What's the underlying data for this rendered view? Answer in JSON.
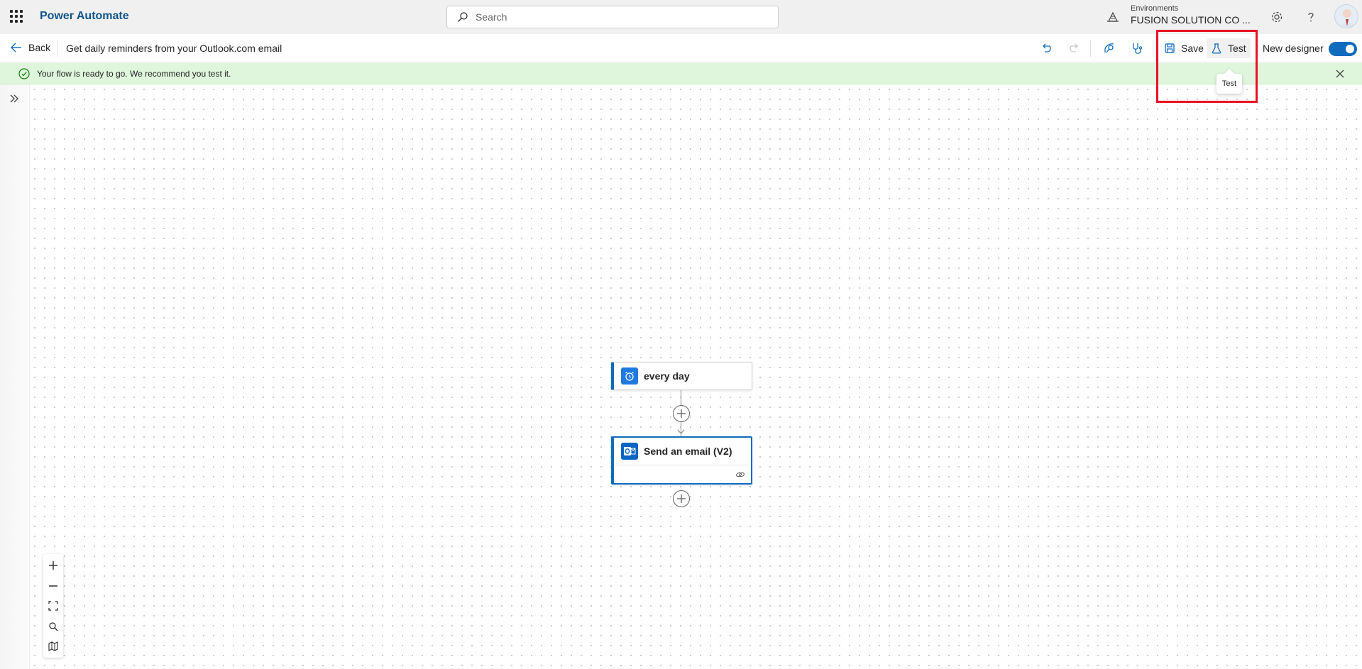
{
  "header": {
    "app_name": "Power Automate",
    "search_placeholder": "Search",
    "environment_label": "Environments",
    "environment_name": "FUSION SOLUTION CO ..."
  },
  "commandbar": {
    "back_label": "Back",
    "flow_title": "Get daily reminders from your Outlook.com email",
    "save_label": "Save",
    "test_label": "Test",
    "new_designer_label": "New designer",
    "new_designer_on": true,
    "tooltip": "Test"
  },
  "message": {
    "text": "Your flow is ready to go. We recommend you test it."
  },
  "flow": {
    "trigger_title": "every day",
    "action_title": "Send an email (V2)"
  },
  "colors": {
    "brand": "#0f548c",
    "accent": "#0f6cbd",
    "success_bg": "#dff6dd",
    "highlight": "#e81123"
  },
  "icons": [
    "waffle-icon",
    "search-icon",
    "environment-icon",
    "settings-icon",
    "help-icon",
    "back-arrow-icon",
    "undo-icon",
    "redo-icon",
    "flow-checker-icon",
    "stethoscope-icon",
    "save-icon",
    "beaker-icon",
    "success-check-icon",
    "close-icon",
    "expand-icon",
    "alarm-clock-icon",
    "outlook-icon",
    "link-icon",
    "plus-icon",
    "minus-icon",
    "fit-view-icon",
    "zoom-search-icon",
    "minimap-icon"
  ]
}
